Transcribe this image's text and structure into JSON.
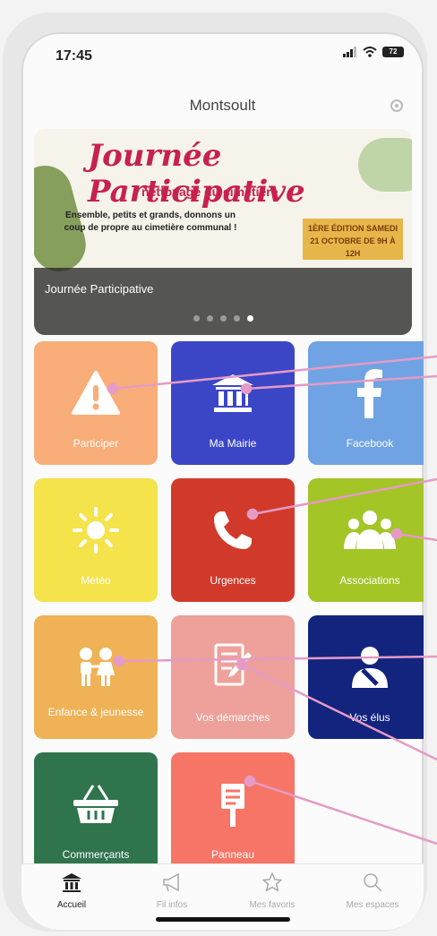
{
  "status": {
    "time": "17:45",
    "battery": "72"
  },
  "header": {
    "title": "Montsoult"
  },
  "banner": {
    "title": "Journée Participative",
    "subtitle": "nettoyage du cimetière",
    "text": "Ensemble, petits et grands, donnons un coup de propre au cimetière communal !",
    "badge": "1ÈRE ÉDITION SAMEDI 21 OCTOBRE DE 9H À 12H",
    "caption": "Journée Participative",
    "slides": 5,
    "active_slide": 5
  },
  "tiles": [
    {
      "label": "Participer",
      "icon": "warning-icon",
      "color": "#f9ad78"
    },
    {
      "label": "Ma Mairie",
      "icon": "town-hall-icon",
      "color": "#3b46c7"
    },
    {
      "label": "Facebook",
      "icon": "facebook-icon",
      "color": "#6fa3e4"
    },
    {
      "label": "Météo",
      "icon": "sun-icon",
      "color": "#f4e34a"
    },
    {
      "label": "Urgences",
      "icon": "phone-icon",
      "color": "#d13a2a"
    },
    {
      "label": "Associations",
      "icon": "group-icon",
      "color": "#a3c526"
    },
    {
      "label": "Enfance & jeunesse",
      "icon": "children-icon",
      "color": "#efb257"
    },
    {
      "label": "Vos démarches",
      "icon": "document-pen-icon",
      "color": "#eea09a"
    },
    {
      "label": "Vos élus",
      "icon": "elected-person-icon",
      "color": "#13247e"
    },
    {
      "label": "Commerçants",
      "icon": "basket-icon",
      "color": "#2f744d"
    },
    {
      "label": "Panneau",
      "icon": "signboard-icon",
      "color": "#f67566"
    }
  ],
  "tabs": [
    {
      "label": "Accueil",
      "icon": "home-icon",
      "active": true
    },
    {
      "label": "Fil infos",
      "icon": "megaphone-icon",
      "active": false
    },
    {
      "label": "Mes favoris",
      "icon": "star-icon",
      "active": false
    },
    {
      "label": "Mes espaces",
      "icon": "search-icon",
      "active": false
    }
  ],
  "colors": {
    "annotation_line": "#e59bc6"
  }
}
